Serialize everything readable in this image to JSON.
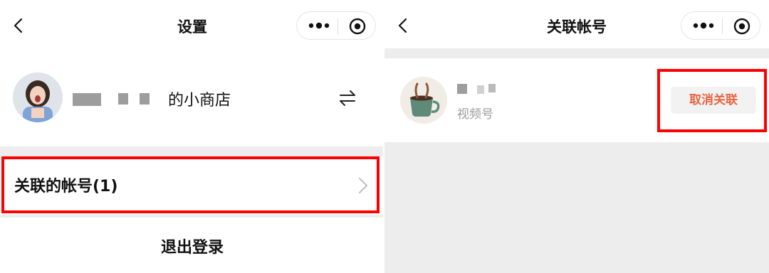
{
  "left": {
    "title": "设置",
    "shop_name": "的小商店",
    "linked_accounts_label": "关联的帐号(1)",
    "logout_label": "退出登录"
  },
  "right": {
    "title": "关联帐号",
    "account_type": "视频号",
    "unlink_label": "取消关联"
  },
  "icons": {
    "back": "chevron-left-icon",
    "more": "more-dots-icon",
    "close_target": "target-icon",
    "switch": "switch-arrows-icon",
    "row_arrow": "chevron-right-icon"
  },
  "colors": {
    "highlight": "#ff0000",
    "unlink_text": "#e9653f",
    "background_gray": "#ededed"
  }
}
